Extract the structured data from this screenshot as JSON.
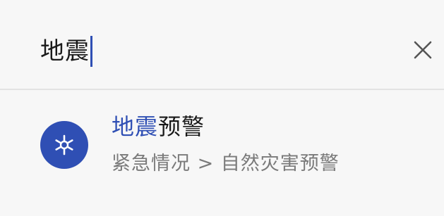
{
  "search": {
    "query": "地震",
    "clear_icon": "close-icon"
  },
  "colors": {
    "accent": "#2f4fb4",
    "background": "#f7f7f7",
    "text_primary": "#1a1a1a",
    "text_secondary": "#7a7a7a"
  },
  "results": [
    {
      "icon": "asterisk-emergency-icon",
      "title_match": "地震",
      "title_rest": "预警",
      "subtitle": "紧急情况 > 自然灾害预警"
    }
  ]
}
